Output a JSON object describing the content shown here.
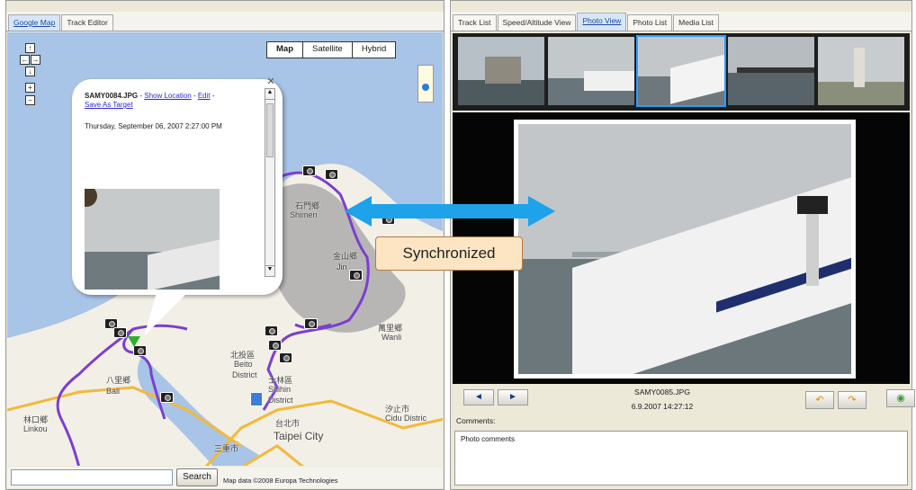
{
  "left_panel": {
    "tabs": [
      "Google Map",
      "Track Editor"
    ],
    "map_types": [
      "Map",
      "Satellite",
      "Hybrid"
    ],
    "pan_controls": [
      "↑",
      "←",
      "→",
      "↓",
      "+",
      "−"
    ],
    "balloon": {
      "filename": "SAMY0084.JPG",
      "separator1": " - ",
      "show_location": "Show Location",
      "separator2": " - ",
      "edit": "Edit",
      "separator3": " - ",
      "save_as_target": "Save As Target",
      "timestamp": "Thursday, September 06, 2007 2:27:00 PM"
    },
    "map_labels": {
      "shimen_cn": "石門鄉",
      "shimen": "Shimen",
      "jinshan_cn": "金山鄉",
      "jinshan": "Jin",
      "wanli_cn": "萬里鄉",
      "wanli": "Wanli",
      "beitou_cn": "北投區",
      "beitou": "Beito",
      "district": "District",
      "bali_cn": "八里鄉",
      "bali": "Bali",
      "shilin_cn": "士林區",
      "shilin": "Shihin",
      "shilin_district": "District",
      "linkou_cn": "林口鄉",
      "linkou": "Linkou",
      "xizhi_cn": "汐止市",
      "cidu": "Cidu Distric",
      "taipei_cn": "台北市",
      "taipei": "Taipei City",
      "sanchong_cn": "三重市"
    },
    "search_button": "Search",
    "search_value": "",
    "copyright": "Map data ©2008 Europa Technologies"
  },
  "right_panel": {
    "tabs": [
      "Track List",
      "Speed/Altitude View",
      "Photo View",
      "Photo List",
      "Media List"
    ],
    "active_tab": "Photo View",
    "photo_filename": "SAMY0085.JPG",
    "photo_datetime": "6.9.2007 14:27:12",
    "prev_label": "◄",
    "next_label": "►",
    "comments_label": "Comments:",
    "comments_text": "Photo comments"
  },
  "overlay": {
    "sync_label": "Synchronized"
  },
  "colors": {
    "sea": "#a8c4e6",
    "land": "#f2efe6",
    "track": "#7b3fd0",
    "sync_arrow": "#1ea2ea",
    "sync_label_bg": "#fde4c2"
  }
}
